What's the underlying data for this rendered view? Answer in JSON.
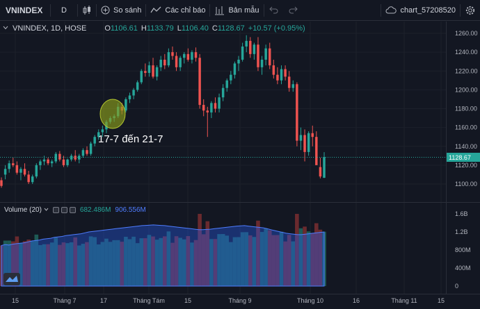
{
  "toolbar": {
    "symbol": "VNINDEX",
    "interval": "D",
    "compare_label": "So sánh",
    "indicators_label": "Các chỉ báo",
    "template_label": "Bản mẫu",
    "chart_name": "chart_57208520"
  },
  "legend": {
    "title": "VNINDEX, 1D, HOSE",
    "open_label": "O",
    "open": "1106.61",
    "high_label": "H",
    "high": "1133.79",
    "low_label": "L",
    "low": "1106.40",
    "close_label": "C",
    "close": "1128.67",
    "change": "+10.57 (+0.95%)"
  },
  "volume_legend": {
    "title": "Volume (20)",
    "vol": "682.486M",
    "ma": "906.556M"
  },
  "annotation": {
    "label": "17-7 đến 21-7"
  },
  "price_axis": {
    "labels": [
      "1260.00",
      "1240.00",
      "1220.00",
      "1200.00",
      "1180.00",
      "1160.00",
      "1140.00",
      "1120.00",
      "1100.00"
    ],
    "last_price": "1128.67"
  },
  "volume_axis": {
    "labels": [
      "1.6B",
      "1.2B",
      "800M",
      "400M",
      "0"
    ]
  },
  "time_axis": {
    "labels": [
      "15",
      "Tháng 7",
      "17",
      "Tháng Tám",
      "15",
      "Tháng 9",
      "Tháng 10",
      "16",
      "Tháng 11",
      "15"
    ]
  },
  "colors": {
    "up": "#26a69a",
    "down": "#ef5350",
    "volume_ma": "#2962ff",
    "highlight": "#9bb31e"
  },
  "chart_data": {
    "type": "candlestick",
    "title": "VNINDEX, 1D, HOSE",
    "y_range": [
      1095,
      1267
    ],
    "candles": [
      {
        "o": 1104,
        "h": 1107,
        "l": 1096,
        "c": 1098
      },
      {
        "o": 1110,
        "h": 1120,
        "l": 1105,
        "c": 1116
      },
      {
        "o": 1116,
        "h": 1125,
        "l": 1112,
        "c": 1122
      },
      {
        "o": 1122,
        "h": 1128,
        "l": 1118,
        "c": 1120
      },
      {
        "o": 1120,
        "h": 1124,
        "l": 1110,
        "c": 1112
      },
      {
        "o": 1112,
        "h": 1118,
        "l": 1104,
        "c": 1116
      },
      {
        "o": 1116,
        "h": 1122,
        "l": 1108,
        "c": 1110
      },
      {
        "o": 1110,
        "h": 1114,
        "l": 1100,
        "c": 1102
      },
      {
        "o": 1102,
        "h": 1110,
        "l": 1100,
        "c": 1108
      },
      {
        "o": 1108,
        "h": 1122,
        "l": 1106,
        "c": 1120
      },
      {
        "o": 1120,
        "h": 1126,
        "l": 1115,
        "c": 1124
      },
      {
        "o": 1124,
        "h": 1130,
        "l": 1120,
        "c": 1126
      },
      {
        "o": 1126,
        "h": 1128,
        "l": 1120,
        "c": 1122
      },
      {
        "o": 1122,
        "h": 1126,
        "l": 1118,
        "c": 1124
      },
      {
        "o": 1124,
        "h": 1134,
        "l": 1122,
        "c": 1132
      },
      {
        "o": 1132,
        "h": 1135,
        "l": 1124,
        "c": 1126
      },
      {
        "o": 1126,
        "h": 1130,
        "l": 1118,
        "c": 1120
      },
      {
        "o": 1120,
        "h": 1127,
        "l": 1118,
        "c": 1126
      },
      {
        "o": 1126,
        "h": 1132,
        "l": 1124,
        "c": 1130
      },
      {
        "o": 1130,
        "h": 1136,
        "l": 1124,
        "c": 1126
      },
      {
        "o": 1126,
        "h": 1132,
        "l": 1122,
        "c": 1130
      },
      {
        "o": 1130,
        "h": 1138,
        "l": 1128,
        "c": 1136
      },
      {
        "o": 1136,
        "h": 1140,
        "l": 1130,
        "c": 1132
      },
      {
        "o": 1132,
        "h": 1145,
        "l": 1130,
        "c": 1143
      },
      {
        "o": 1143,
        "h": 1152,
        "l": 1140,
        "c": 1150
      },
      {
        "o": 1150,
        "h": 1158,
        "l": 1147,
        "c": 1155
      },
      {
        "o": 1155,
        "h": 1162,
        "l": 1150,
        "c": 1158
      },
      {
        "o": 1158,
        "h": 1168,
        "l": 1154,
        "c": 1166
      },
      {
        "o": 1166,
        "h": 1172,
        "l": 1164,
        "c": 1170
      },
      {
        "o": 1170,
        "h": 1174,
        "l": 1166,
        "c": 1172
      },
      {
        "o": 1172,
        "h": 1186,
        "l": 1170,
        "c": 1182
      },
      {
        "o": 1182,
        "h": 1186,
        "l": 1174,
        "c": 1178
      },
      {
        "o": 1178,
        "h": 1192,
        "l": 1176,
        "c": 1190
      },
      {
        "o": 1190,
        "h": 1197,
        "l": 1186,
        "c": 1194
      },
      {
        "o": 1194,
        "h": 1202,
        "l": 1190,
        "c": 1200
      },
      {
        "o": 1200,
        "h": 1210,
        "l": 1198,
        "c": 1208
      },
      {
        "o": 1208,
        "h": 1222,
        "l": 1206,
        "c": 1220
      },
      {
        "o": 1220,
        "h": 1228,
        "l": 1214,
        "c": 1218
      },
      {
        "o": 1218,
        "h": 1230,
        "l": 1214,
        "c": 1226
      },
      {
        "o": 1226,
        "h": 1234,
        "l": 1212,
        "c": 1214
      },
      {
        "o": 1214,
        "h": 1226,
        "l": 1210,
        "c": 1224
      },
      {
        "o": 1224,
        "h": 1236,
        "l": 1220,
        "c": 1232
      },
      {
        "o": 1232,
        "h": 1238,
        "l": 1222,
        "c": 1226
      },
      {
        "o": 1226,
        "h": 1244,
        "l": 1224,
        "c": 1240
      },
      {
        "o": 1240,
        "h": 1246,
        "l": 1232,
        "c": 1236
      },
      {
        "o": 1236,
        "h": 1240,
        "l": 1220,
        "c": 1224
      },
      {
        "o": 1224,
        "h": 1236,
        "l": 1220,
        "c": 1234
      },
      {
        "o": 1234,
        "h": 1240,
        "l": 1228,
        "c": 1238
      },
      {
        "o": 1238,
        "h": 1244,
        "l": 1230,
        "c": 1232
      },
      {
        "o": 1232,
        "h": 1242,
        "l": 1228,
        "c": 1240
      },
      {
        "o": 1240,
        "h": 1245,
        "l": 1230,
        "c": 1234
      },
      {
        "o": 1234,
        "h": 1238,
        "l": 1180,
        "c": 1184
      },
      {
        "o": 1184,
        "h": 1190,
        "l": 1172,
        "c": 1178
      },
      {
        "o": 1178,
        "h": 1182,
        "l": 1150,
        "c": 1176
      },
      {
        "o": 1176,
        "h": 1188,
        "l": 1170,
        "c": 1186
      },
      {
        "o": 1186,
        "h": 1192,
        "l": 1176,
        "c": 1180
      },
      {
        "o": 1180,
        "h": 1196,
        "l": 1176,
        "c": 1192
      },
      {
        "o": 1192,
        "h": 1206,
        "l": 1188,
        "c": 1202
      },
      {
        "o": 1202,
        "h": 1212,
        "l": 1198,
        "c": 1210
      },
      {
        "o": 1210,
        "h": 1220,
        "l": 1206,
        "c": 1216
      },
      {
        "o": 1216,
        "h": 1230,
        "l": 1212,
        "c": 1228
      },
      {
        "o": 1228,
        "h": 1236,
        "l": 1220,
        "c": 1232
      },
      {
        "o": 1232,
        "h": 1250,
        "l": 1230,
        "c": 1246
      },
      {
        "o": 1246,
        "h": 1258,
        "l": 1240,
        "c": 1252
      },
      {
        "o": 1252,
        "h": 1256,
        "l": 1234,
        "c": 1238
      },
      {
        "o": 1238,
        "h": 1250,
        "l": 1232,
        "c": 1248
      },
      {
        "o": 1248,
        "h": 1256,
        "l": 1220,
        "c": 1224
      },
      {
        "o": 1224,
        "h": 1236,
        "l": 1216,
        "c": 1232
      },
      {
        "o": 1232,
        "h": 1248,
        "l": 1226,
        "c": 1244
      },
      {
        "o": 1244,
        "h": 1250,
        "l": 1222,
        "c": 1226
      },
      {
        "o": 1226,
        "h": 1232,
        "l": 1212,
        "c": 1216
      },
      {
        "o": 1216,
        "h": 1224,
        "l": 1206,
        "c": 1210
      },
      {
        "o": 1210,
        "h": 1226,
        "l": 1206,
        "c": 1222
      },
      {
        "o": 1222,
        "h": 1226,
        "l": 1210,
        "c": 1214
      },
      {
        "o": 1214,
        "h": 1220,
        "l": 1198,
        "c": 1202
      },
      {
        "o": 1202,
        "h": 1210,
        "l": 1198,
        "c": 1206
      },
      {
        "o": 1206,
        "h": 1208,
        "l": 1140,
        "c": 1146
      },
      {
        "o": 1146,
        "h": 1160,
        "l": 1136,
        "c": 1152
      },
      {
        "o": 1152,
        "h": 1158,
        "l": 1124,
        "c": 1134
      },
      {
        "o": 1134,
        "h": 1156,
        "l": 1130,
        "c": 1154
      },
      {
        "o": 1154,
        "h": 1162,
        "l": 1140,
        "c": 1150
      },
      {
        "o": 1150,
        "h": 1156,
        "l": 1124,
        "c": 1120
      },
      {
        "o": 1118,
        "h": 1128,
        "l": 1106,
        "c": 1108
      },
      {
        "o": 1106.61,
        "h": 1133.79,
        "l": 1106.4,
        "c": 1128.67
      }
    ],
    "volume_ma": [
      900,
      920,
      910,
      930,
      940,
      950,
      960,
      980,
      1000,
      1010,
      1020,
      1040,
      1050,
      1060,
      1080,
      1090,
      1100,
      1120,
      1130,
      1140,
      1150,
      1160,
      1180,
      1200,
      1210,
      1220,
      1230,
      1240,
      1250,
      1260,
      1270,
      1280,
      1290,
      1300,
      1310,
      1320,
      1330,
      1340,
      1345,
      1350,
      1355,
      1350,
      1345,
      1340,
      1330,
      1320,
      1310,
      1300,
      1290,
      1280,
      1270,
      1260,
      1250,
      1250,
      1255,
      1260,
      1270,
      1280,
      1290,
      1300,
      1310,
      1320,
      1330,
      1335,
      1340,
      1330,
      1320,
      1310,
      1300,
      1290,
      1270,
      1250,
      1230,
      1210,
      1190,
      1170,
      1160,
      1150,
      1140,
      1140,
      1150,
      1160,
      1170,
      1180,
      1190,
      1200
    ]
  }
}
